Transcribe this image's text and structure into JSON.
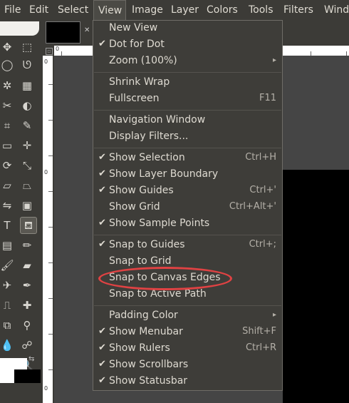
{
  "menubar": {
    "items": [
      "File",
      "Edit",
      "Select",
      "View",
      "Image",
      "Layer",
      "Colors",
      "Tools",
      "Filters",
      "Wind"
    ],
    "active": "View"
  },
  "rulers": {
    "hruler_zero": "0",
    "vruler_labels": [
      "0",
      "0",
      "0"
    ]
  },
  "view_menu": {
    "new_view": {
      "label": "New View",
      "checked": false
    },
    "dot_for_dot": {
      "label": "Dot for Dot",
      "checked": true
    },
    "zoom": {
      "label": "Zoom (100%)",
      "submenu": true
    },
    "shrink_wrap": {
      "label": "Shrink Wrap"
    },
    "fullscreen": {
      "label": "Fullscreen",
      "shortcut": "F11"
    },
    "navigation_window": {
      "label": "Navigation Window"
    },
    "display_filters": {
      "label": "Display Filters..."
    },
    "show_selection": {
      "label": "Show Selection",
      "shortcut": "Ctrl+H",
      "checked": true
    },
    "show_layer_boundary": {
      "label": "Show Layer Boundary",
      "checked": true
    },
    "show_guides": {
      "label": "Show Guides",
      "shortcut": "Ctrl+'",
      "checked": true
    },
    "show_grid": {
      "label": "Show Grid",
      "shortcut": "Ctrl+Alt+'",
      "checked": false
    },
    "show_sample_points": {
      "label": "Show Sample Points",
      "checked": true
    },
    "snap_to_guides": {
      "label": "Snap to Guides",
      "shortcut": "Ctrl+;",
      "checked": true
    },
    "snap_to_grid": {
      "label": "Snap to Grid",
      "checked": false
    },
    "snap_to_canvas_edges": {
      "label": "Snap to Canvas Edges",
      "checked": false,
      "highlighted_color": "#e04243"
    },
    "snap_to_active_path": {
      "label": "Snap to Active Path",
      "checked": false
    },
    "padding_color": {
      "label": "Padding Color",
      "submenu": true
    },
    "show_menubar": {
      "label": "Show Menubar",
      "shortcut": "Shift+F",
      "checked": true
    },
    "show_rulers": {
      "label": "Show Rulers",
      "shortcut": "Ctrl+R",
      "checked": true
    },
    "show_scrollbars": {
      "label": "Show Scrollbars",
      "checked": true
    },
    "show_statusbar": {
      "label": "Show Statusbar",
      "checked": true
    }
  },
  "icons": {
    "check": "✔",
    "submenu_arrow": "▸"
  },
  "colors": {
    "menu_bg": "#3e3d39",
    "menubar_bg": "#3c3b37",
    "text": "#dfdbd2",
    "annotation_red": "#e04243"
  }
}
